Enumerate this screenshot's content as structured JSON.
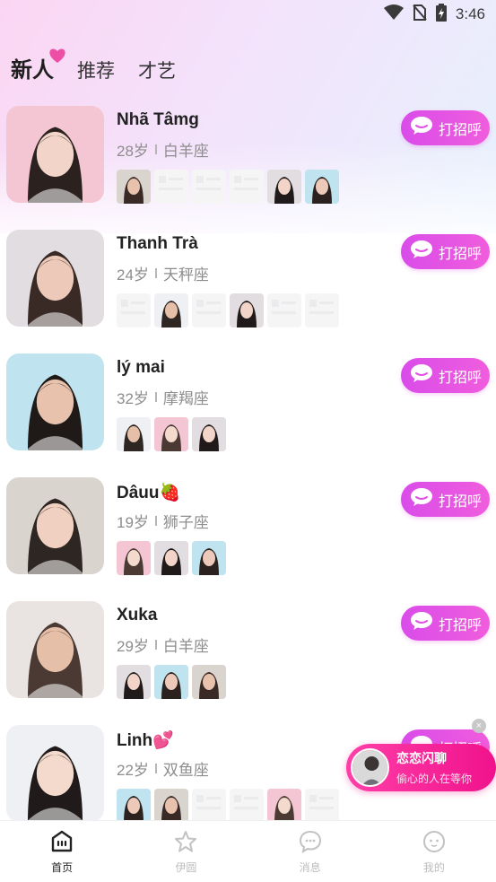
{
  "status": {
    "time": "3:46"
  },
  "tabs": [
    {
      "label": "新人",
      "active": true
    },
    {
      "label": "推荐",
      "active": false
    },
    {
      "label": "才艺",
      "active": false
    }
  ],
  "greet_label": "打招呼",
  "users": [
    {
      "name": "Nhã Tâmg",
      "age": "28岁",
      "sign": "白羊座",
      "photos": [
        "photo",
        "ph",
        "ph",
        "ph",
        "photo",
        "photo"
      ]
    },
    {
      "name": "Thanh Trà",
      "age": "24岁",
      "sign": "天秤座",
      "photos": [
        "ph",
        "photo",
        "ph",
        "photo",
        "ph",
        "ph"
      ]
    },
    {
      "name": "lý mai",
      "age": "32岁",
      "sign": "摩羯座",
      "photos": [
        "photo",
        "photo",
        "photo"
      ]
    },
    {
      "name": "Dâuu🍓",
      "age": "19岁",
      "sign": "狮子座",
      "photos": [
        "photo",
        "photo",
        "photo"
      ]
    },
    {
      "name": "Xuka",
      "age": "29岁",
      "sign": "白羊座",
      "photos": [
        "photo",
        "photo",
        "photo"
      ]
    },
    {
      "name": "Linh💕",
      "age": "22岁",
      "sign": "双鱼座",
      "photos": [
        "photo",
        "photo",
        "ph",
        "ph",
        "photo",
        "ph"
      ]
    }
  ],
  "float_card": {
    "title": "恋恋闪聊",
    "subtitle": "偷心的人在等你"
  },
  "bottom_nav": [
    {
      "label": "首页",
      "icon": "home-icon",
      "active": true
    },
    {
      "label": "伊圆",
      "icon": "star-icon",
      "active": false
    },
    {
      "label": "消息",
      "icon": "message-icon",
      "active": false
    },
    {
      "label": "我的",
      "icon": "profile-icon",
      "active": false
    }
  ],
  "colors": {
    "accent": "#e351e4",
    "float": "#f0128c"
  }
}
